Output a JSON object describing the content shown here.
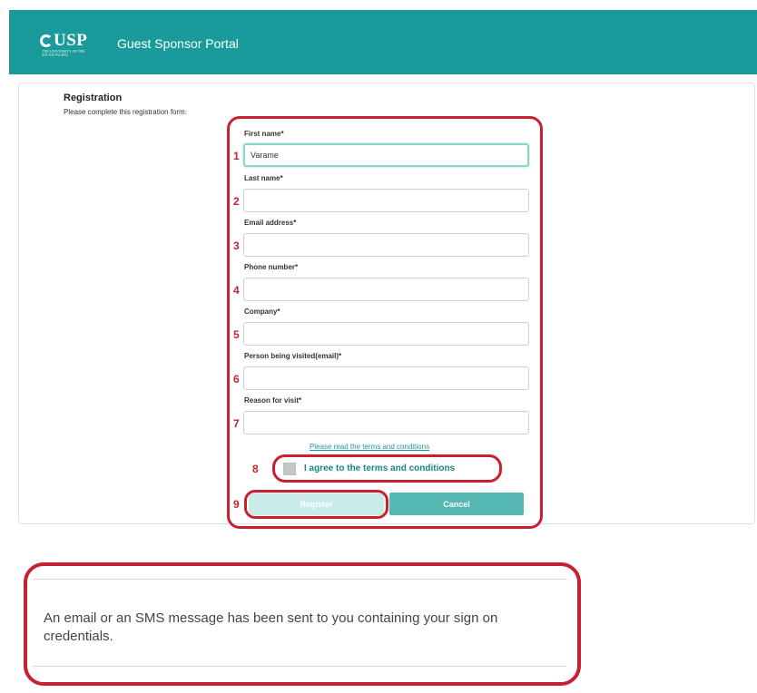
{
  "header": {
    "logo_text": "USP",
    "logo_subtext": "THE UNIVERSITY OF THE SOUTH PACIFIC",
    "title": "Guest Sponsor Portal"
  },
  "registration": {
    "title": "Registration",
    "subtitle": "Please complete this registration form:"
  },
  "fields": [
    {
      "number": "1",
      "label": "First name*",
      "value": "Varame",
      "placeholder": ""
    },
    {
      "number": "2",
      "label": "Last name*",
      "value": "",
      "placeholder": ""
    },
    {
      "number": "3",
      "label": "Email address*",
      "value": "",
      "placeholder": ""
    },
    {
      "number": "4",
      "label": "Phone number*",
      "value": "",
      "placeholder": ""
    },
    {
      "number": "5",
      "label": "Company*",
      "value": "",
      "placeholder": ""
    },
    {
      "number": "6",
      "label": "Person being visited(email)*",
      "value": "",
      "placeholder": ""
    },
    {
      "number": "7",
      "label": "Reason for visit*",
      "value": "",
      "placeholder": ""
    }
  ],
  "terms": {
    "link_text": "Please read the terms and conditions",
    "number": "8",
    "agree_label": "I agree to the terms and conditions",
    "checked": false
  },
  "actions": {
    "number": "9",
    "register_label": "Register",
    "cancel_label": "Cancel"
  },
  "message": {
    "text": "An email or an SMS message has been sent to you containing your sign on credentials."
  },
  "colors": {
    "header": "#1a9a9a",
    "annotation_red": "#c8202f",
    "cancel_button": "#56b9b1",
    "register_button_disabled": "#c9ece9"
  }
}
